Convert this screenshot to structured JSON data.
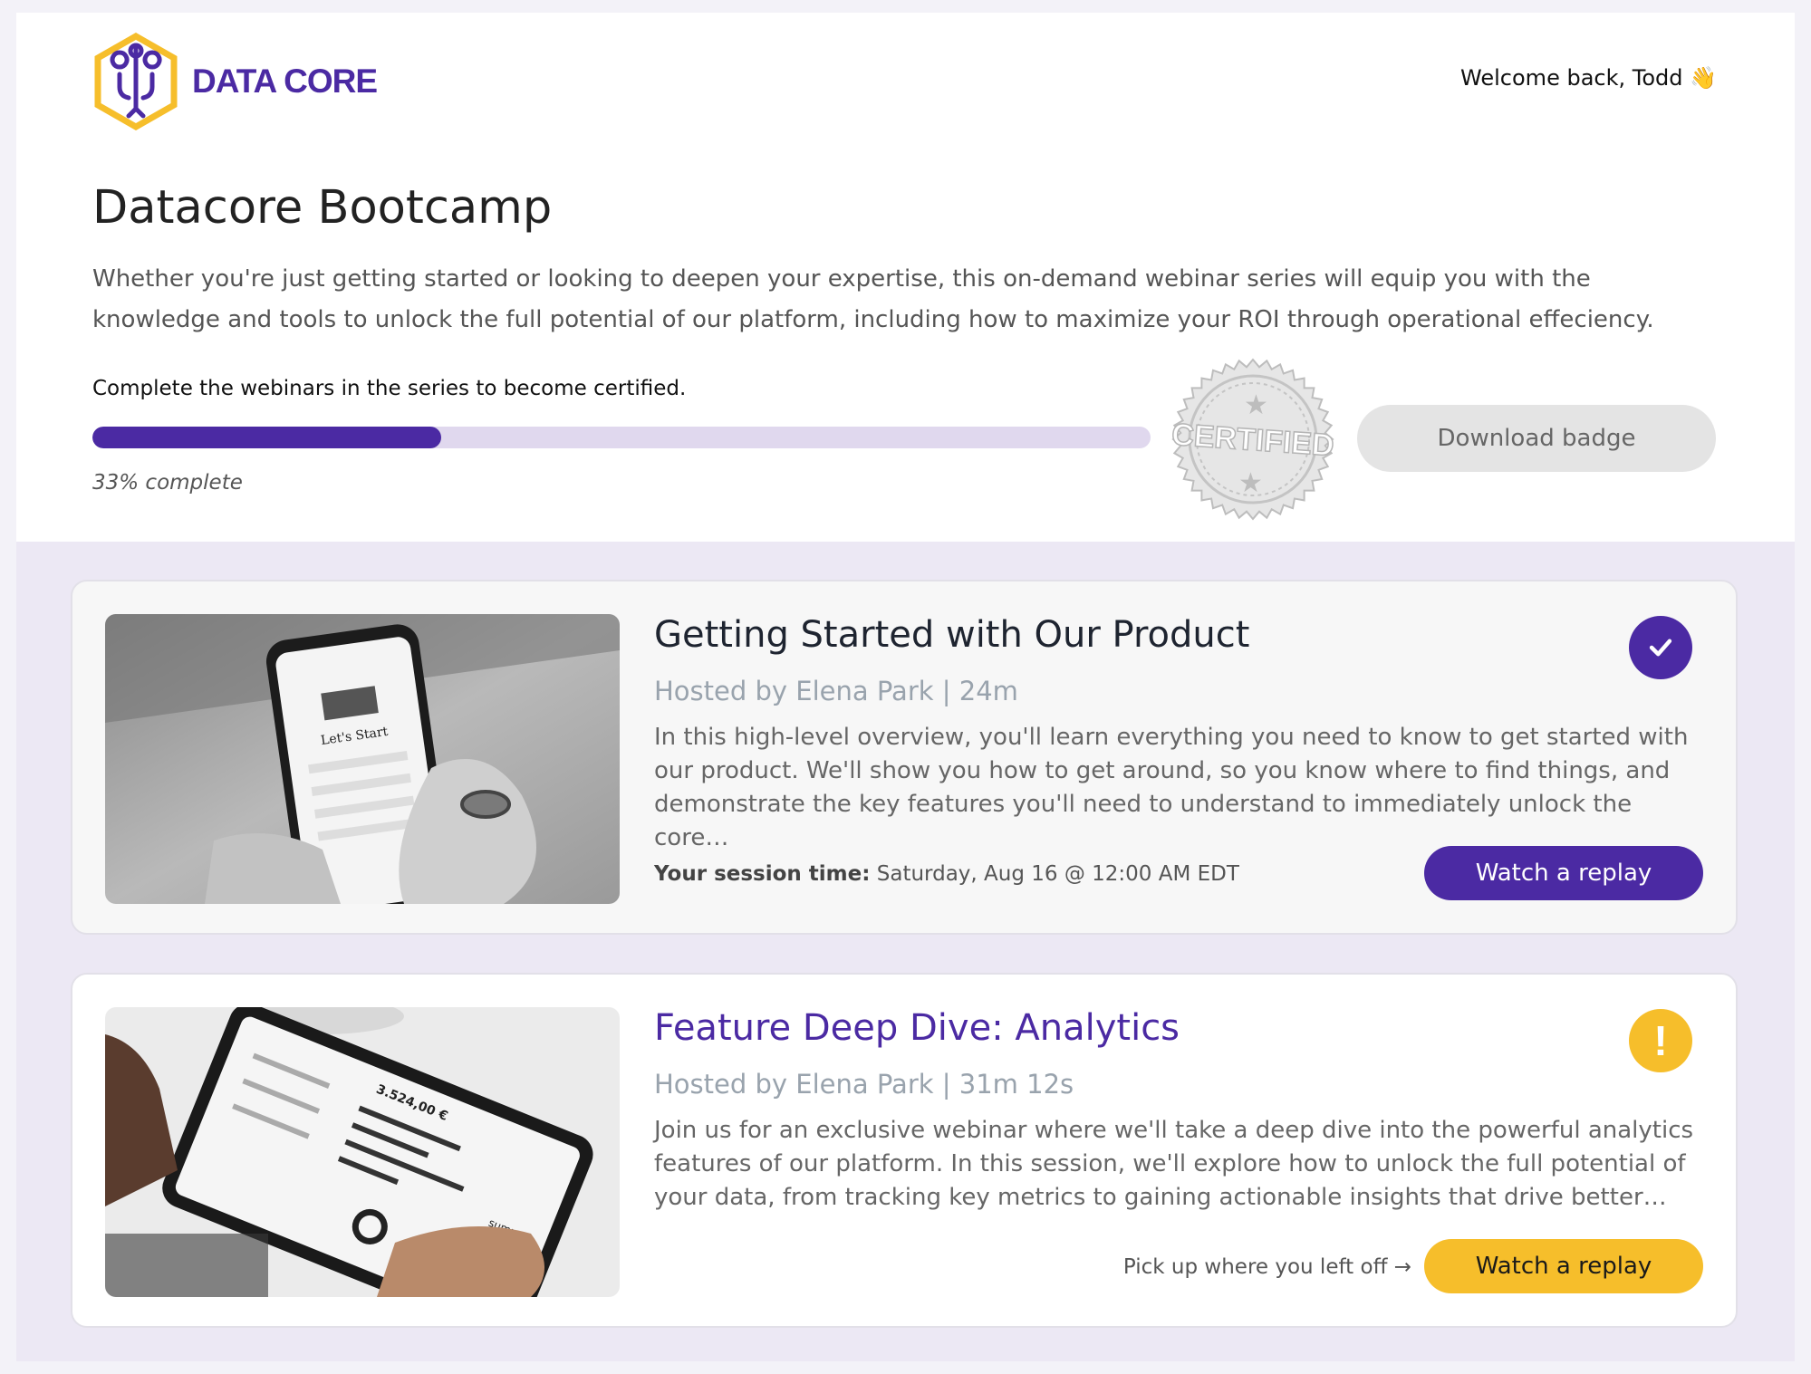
{
  "brand": {
    "logo_text": "DATA CORE",
    "primary_color": "#4b2aa3",
    "accent_color": "#f6be2b"
  },
  "header": {
    "welcome": "Welcome back, Todd 👋"
  },
  "page": {
    "title": "Datacore Bootcamp",
    "description": "Whether you're just getting started or looking to deepen your expertise, this on-demand webinar series will equip you with the knowledge and tools to unlock the full potential of our platform, including how to maximize your ROI through operational effeciency."
  },
  "progress": {
    "instruction": "Complete the webinars in the series to become certified.",
    "percent": 33,
    "label": "33% complete",
    "stamp_text": "CERTIFIED",
    "download_label": "Download badge"
  },
  "webinars": [
    {
      "title": "Getting Started with Our Product",
      "meta": "Hosted by Elena Park | 24m",
      "description": "In this high-level overview, you'll learn everything you need to know to get started with our product. We'll show you how to get around, so you know where to find things, and demonstrate the key features you'll need to understand to immediately unlock the core…",
      "session_label": "Your session time:",
      "session_value": "Saturday, Aug 16 @ 12:00 AM EDT",
      "status": "completed",
      "status_icon": "check-icon",
      "button_label": "Watch a replay",
      "thumb_text": "Let's Start"
    },
    {
      "title": "Feature Deep Dive: Analytics",
      "meta": "Hosted by Elena Park | 31m 12s",
      "description": "Join us for an exclusive webinar where we'll take a deep dive into the powerful analytics features of our platform. In this session, we'll explore how to unlock the full potential of your data, from tracking key metrics to gaining actionable insights that drive better…",
      "resume_hint": "Pick up where you left off →",
      "status": "in-progress",
      "status_icon": "exclamation-icon",
      "status_glyph": "!",
      "button_label": "Watch a replay",
      "thumb_text": "3.524,00 €",
      "thumb_brand": "sumup"
    }
  ]
}
